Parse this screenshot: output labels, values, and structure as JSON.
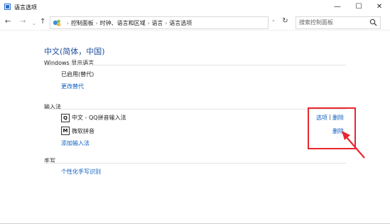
{
  "window": {
    "title": "语言选项",
    "minimize_glyph": "—",
    "maximize_glyph": "☐",
    "close_glyph": "✕"
  },
  "nav": {
    "back_glyph": "←",
    "forward_glyph": "→",
    "up_glyph": "↑",
    "refresh_glyph": "↻"
  },
  "breadcrumb": [
    "控制面板",
    "时钟、语言和区域",
    "语言",
    "语言选项"
  ],
  "search": {
    "placeholder": "搜索控制面板"
  },
  "main": {
    "language_title": "中文(简体，中国)",
    "display_section": {
      "heading": "Windows 显示语言",
      "status": "已启用(替代)",
      "change_link": "更改替代"
    },
    "input_section": {
      "heading": "输入法",
      "methods": [
        {
          "icon": "Q",
          "name": "中文 - QQ拼音输入法",
          "options_link": "选项",
          "separator": "|",
          "remove_link": "删除"
        },
        {
          "icon": "M",
          "name": "微软拼音",
          "remove_link": "删除"
        }
      ],
      "add_link": "添加输入法"
    },
    "handwriting_section": {
      "heading": "手写",
      "personalize_link": "个性化手写识别"
    }
  },
  "colors": {
    "link": "#0b5ec2",
    "title": "#1e4e9e",
    "annotation": "#e8272f"
  },
  "icons": {
    "app": "language-options-icon",
    "address": "control-panel-icon",
    "search": "search-icon"
  }
}
